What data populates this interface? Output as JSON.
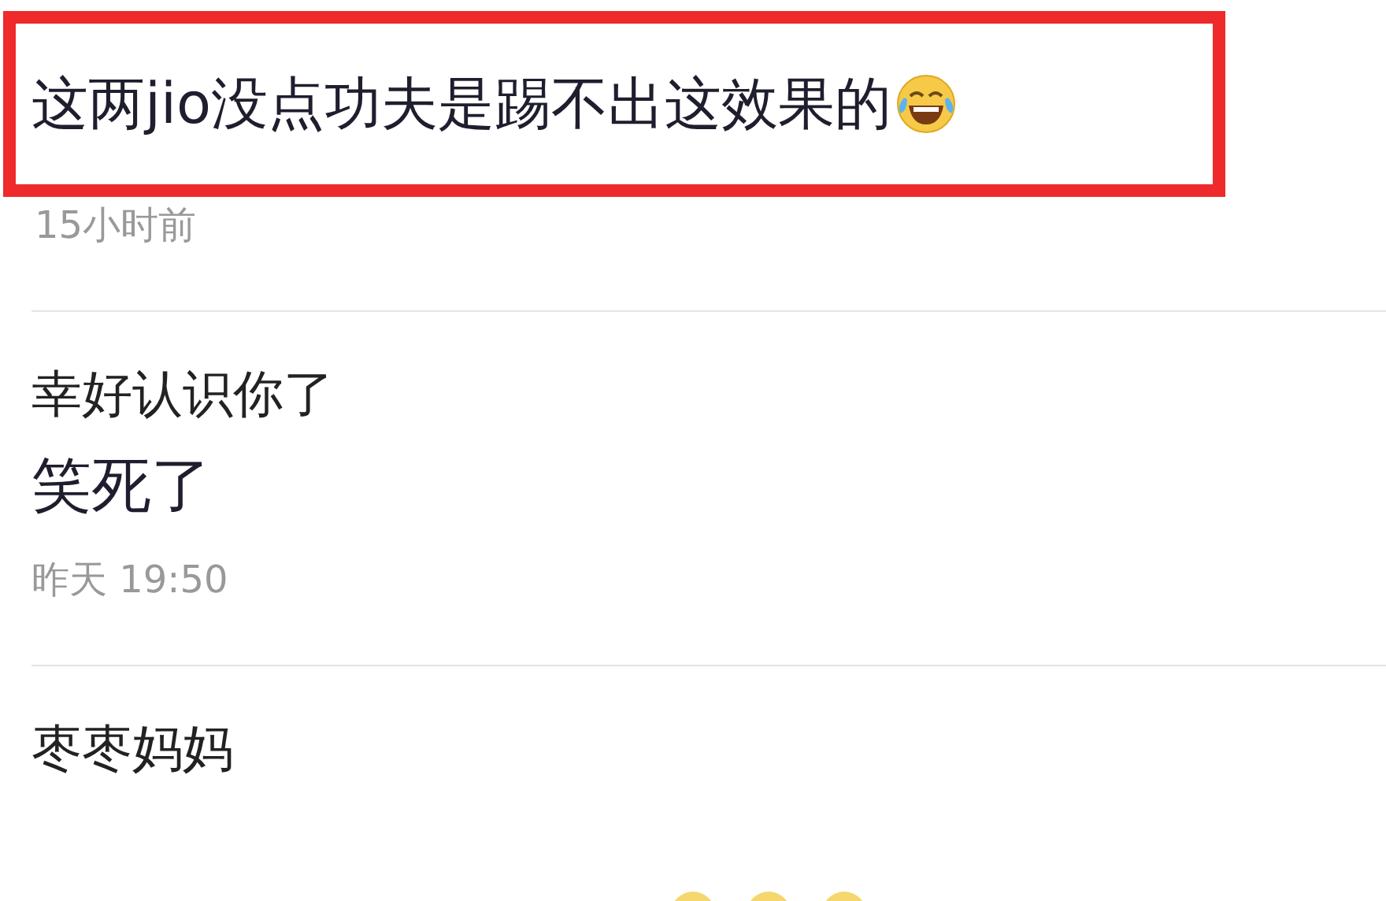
{
  "comments": [
    {
      "content": "这两jio没点功夫是踢不出这效果的",
      "trailing_emoji": true,
      "highlighted": true,
      "time": "15小时前"
    },
    {
      "user": "幸好认识你了",
      "content": "笑死了",
      "highlighted": false,
      "time": "昨天 19:50"
    },
    {
      "user": "枣枣妈妈",
      "highlighted": false
    }
  ]
}
